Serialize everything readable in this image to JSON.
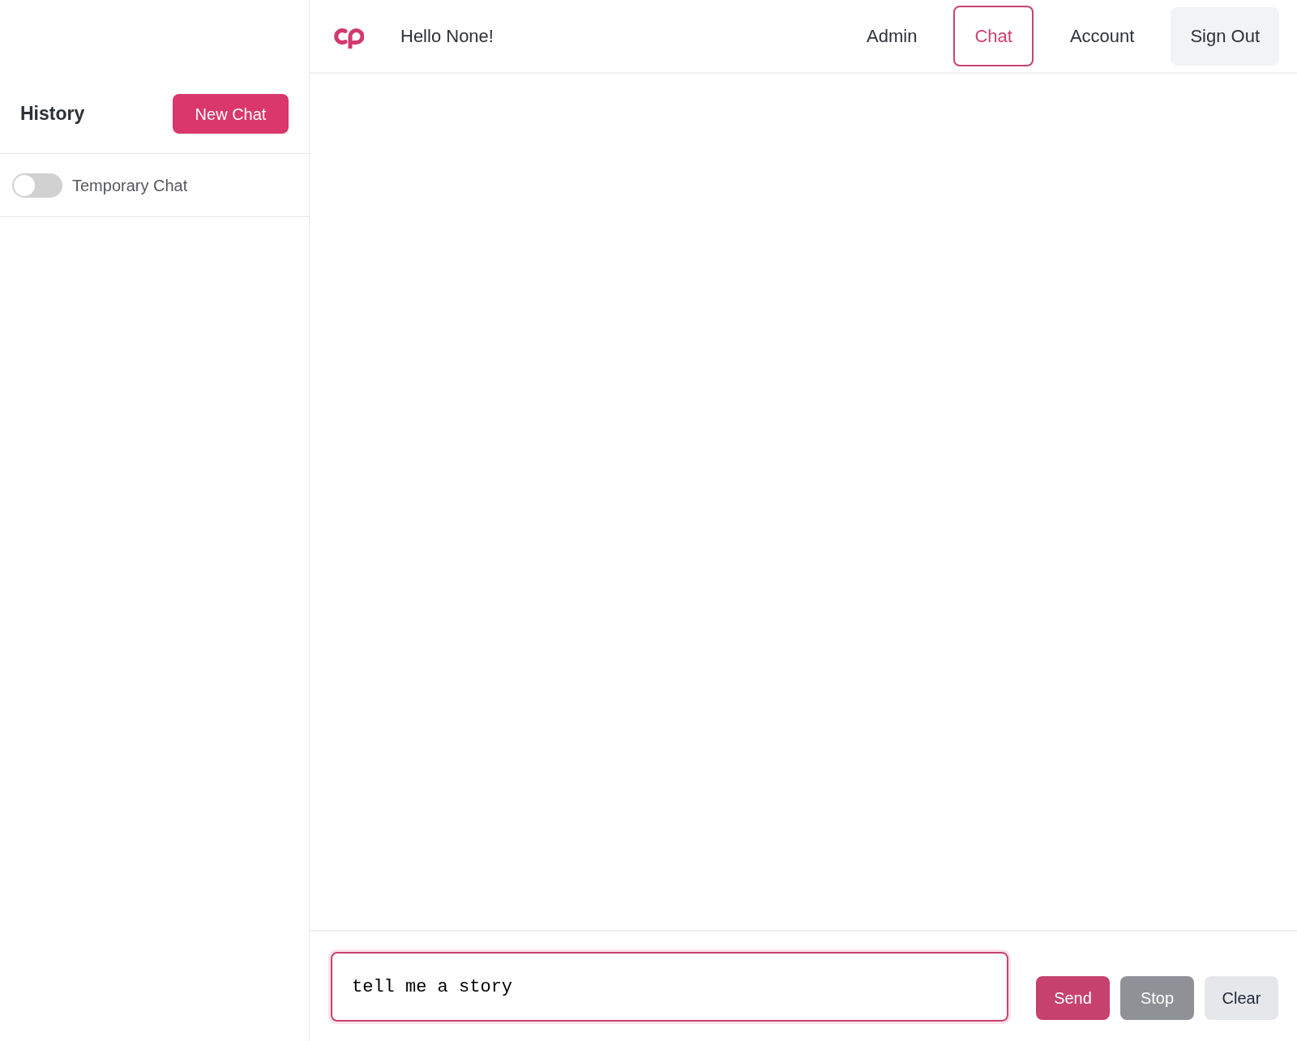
{
  "sidebar": {
    "title": "History",
    "new_chat_button": "New Chat",
    "temporary_chat": {
      "label": "Temporary Chat",
      "on": false
    }
  },
  "header": {
    "greeting": "Hello None!",
    "nav": [
      {
        "label": "Admin",
        "selected": false
      },
      {
        "label": "Chat",
        "selected": true
      },
      {
        "label": "Account",
        "selected": false
      }
    ],
    "sign_out_button": "Sign Out"
  },
  "composer": {
    "value": "tell me a story",
    "buttons": [
      {
        "label": "Send",
        "kind": "primary"
      },
      {
        "label": "Stop",
        "kind": "muted"
      },
      {
        "label": "Clear",
        "kind": "light"
      }
    ]
  }
}
